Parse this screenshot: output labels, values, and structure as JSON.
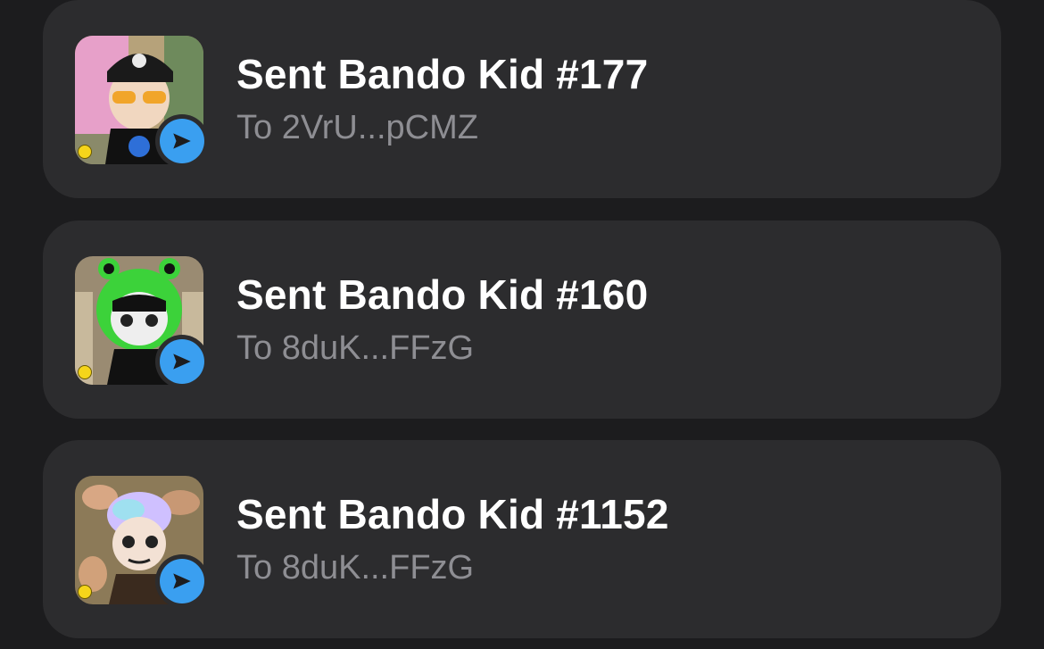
{
  "activity": {
    "items": [
      {
        "title": "Sent Bando Kid #177",
        "subtitle": "To 2VrU...pCMZ",
        "image_icon": "nft-thumbnail",
        "badge_icon": "send-arrow-icon",
        "badge_color": "#3a9ff0"
      },
      {
        "title": "Sent Bando Kid #160",
        "subtitle": "To 8duK...FFzG",
        "image_icon": "nft-thumbnail",
        "badge_icon": "send-arrow-icon",
        "badge_color": "#3a9ff0"
      },
      {
        "title": "Sent Bando Kid #1152",
        "subtitle": "To 8duK...FFzG",
        "image_icon": "nft-thumbnail",
        "badge_icon": "send-arrow-icon",
        "badge_color": "#3a9ff0"
      }
    ]
  }
}
